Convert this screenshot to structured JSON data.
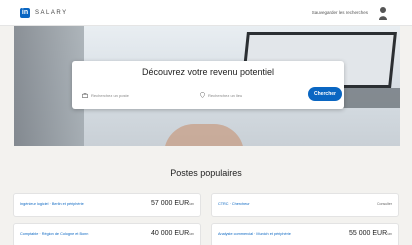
{
  "header": {
    "logo_badge": "in",
    "logo_word": "SALARY",
    "top_link": "Sauvegarder les recherches"
  },
  "hero": {
    "title": "Découvrez votre revenu potentiel",
    "job_placeholder": "Recherchez un poste",
    "location_placeholder": "Recherchez un lieu",
    "search_label": "Chercher"
  },
  "popular": {
    "title": "Postes populaires",
    "cards": [
      {
        "label": "Ingénieur logiciel · Berlin et périphérie",
        "value": "57 000 EUR",
        "suffix": "/an"
      },
      {
        "label": "CTRC · Chercheur",
        "value": "",
        "suffix": "Consulter"
      },
      {
        "label": "Comptable · Région de Cologne et Bonn",
        "value": "40 000 EUR",
        "suffix": "/an"
      },
      {
        "label": "Analyste commercial · Munich et périphérie",
        "value": "55 000 EUR",
        "suffix": "/an"
      }
    ]
  },
  "colors": {
    "brand": "#0a66c2",
    "background": "#f3f2ef"
  }
}
